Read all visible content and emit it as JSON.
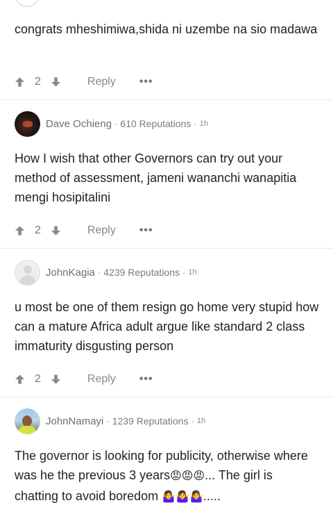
{
  "comments": [
    {
      "text": "congrats mheshimiwa,shida ni uzembe na sio madawa",
      "votes": "2",
      "reply_label": "Reply",
      "more_label": "•••"
    },
    {
      "author": "Dave Ochieng",
      "reputation": "610 Reputations",
      "time": "1h",
      "text": "How I wish that other Governors can try out your method of assessment, jameni wananchi wanapitia mengi hosipitalini",
      "votes": "2",
      "reply_label": "Reply",
      "more_label": "•••"
    },
    {
      "author": "JohnKagia",
      "reputation": "4239 Reputations",
      "time": "1h",
      "text": "u most be one of them resign go home very stupid how can a mature Africa adult argue like standard 2 class immaturity disgusting person",
      "votes": "2",
      "reply_label": "Reply",
      "more_label": "•••"
    },
    {
      "author": "JohnNamayi",
      "reputation": "1239 Reputations",
      "time": "1h",
      "text_part1": "The governor is looking for publicity, otherwise where was he the previous 3 years",
      "emoji_angry": "😡😡😡",
      "text_part2": "... The girl is chatting to avoid boredom ",
      "emoji_shrug": "🤷‍♀️🤷‍♀️🤷‍♀️",
      "text_part3": "....."
    }
  ],
  "separator": "·",
  "colors": {
    "icon_gray": "#8a8a8a",
    "divider": "#e9e9e9"
  }
}
